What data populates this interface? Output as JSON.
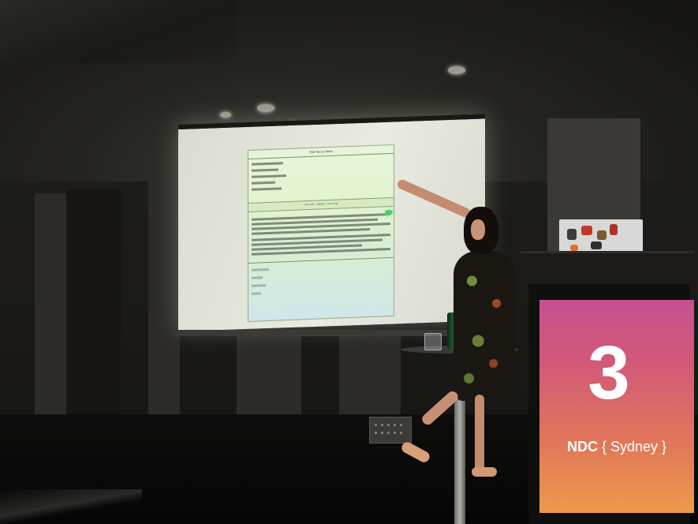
{
  "scene": {
    "description_label": "",
    "slide": {
      "title": "Tab focus tests",
      "banner_text": "Tab order · tabindex · focus ring"
    },
    "podium_sign": {
      "number": "3",
      "brand_bold": "NDC",
      "brand_rest": " { Sydney }"
    }
  },
  "colors": {
    "sign_top": "#c6508f",
    "sign_bottom": "#ec9a4a",
    "slide_bg": "#e2f4cf",
    "pointer": "#52c96d"
  }
}
